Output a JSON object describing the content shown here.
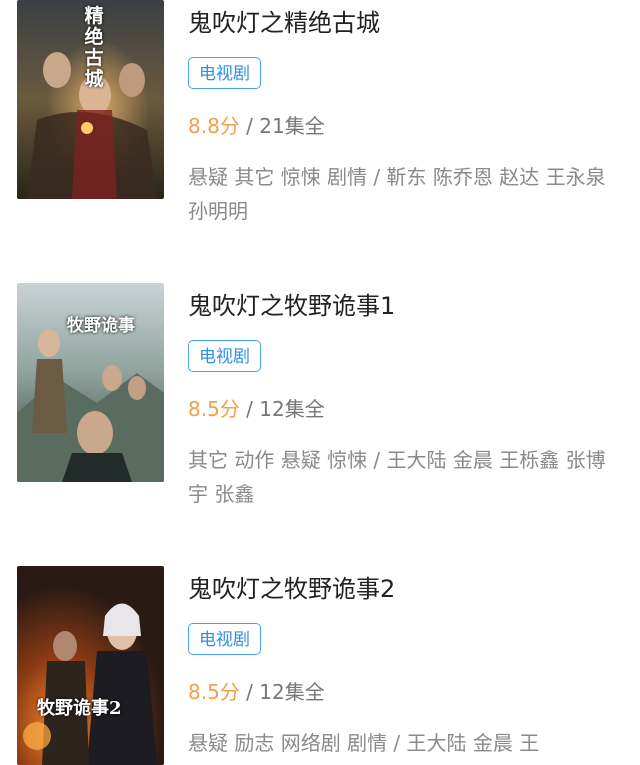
{
  "items": [
    {
      "title": "鬼吹灯之精绝古城",
      "tag": "电视剧",
      "score": "8.8分",
      "separator": "/",
      "episodes": "21集全",
      "description": "悬疑 其它 惊悚 剧情 / 靳东 陈乔恩 赵达 王永泉 孙明明",
      "poster_text": "精绝古城"
    },
    {
      "title": "鬼吹灯之牧野诡事1",
      "tag": "电视剧",
      "score": "8.5分",
      "separator": "/",
      "episodes": "12集全",
      "description": "其它 动作 悬疑 惊悚 / 王大陆 金晨 王栎鑫 张博宇 张鑫",
      "poster_text": "牧野诡事"
    },
    {
      "title": "鬼吹灯之牧野诡事2",
      "tag": "电视剧",
      "score": "8.5分",
      "separator": "/",
      "episodes": "12集全",
      "description": "悬疑 励志 网络剧 剧情 / 王大陆 金晨 王",
      "poster_text": "牧野诡事2"
    }
  ],
  "colors": {
    "score": "#f2a049",
    "tag_border": "#4aa3f0",
    "tag_text": "#2f8fe6",
    "title": "#222222",
    "muted": "#8a8a8a"
  }
}
